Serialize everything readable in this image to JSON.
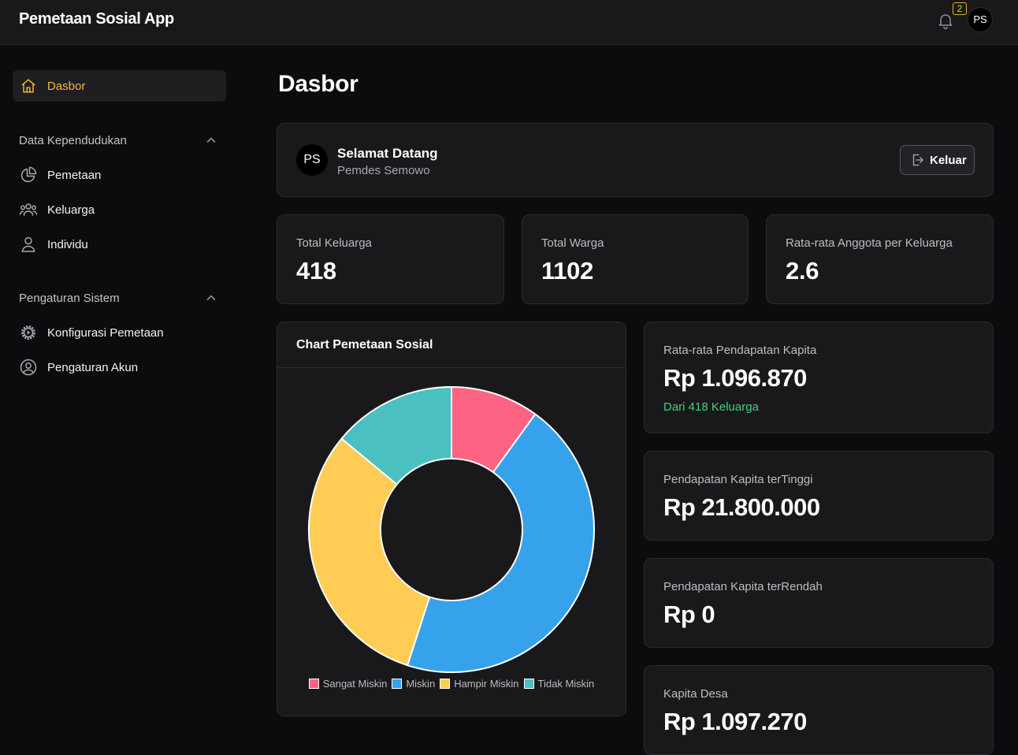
{
  "app": {
    "title": "Pemetaan Sosial App"
  },
  "header": {
    "notification_count": "2",
    "avatar_initials": "PS"
  },
  "sidebar": {
    "active_item": {
      "label": "Dasbor",
      "icon": "home-icon"
    },
    "sections": [
      {
        "title": "Data Kependudukan",
        "items": [
          {
            "label": "Pemetaan",
            "icon": "pie-chart-icon"
          },
          {
            "label": "Keluarga",
            "icon": "users-icon"
          },
          {
            "label": "Individu",
            "icon": "user-icon"
          }
        ]
      },
      {
        "title": "Pengaturan Sistem",
        "items": [
          {
            "label": "Konfigurasi Pemetaan",
            "icon": "gear-icon"
          },
          {
            "label": "Pengaturan Akun",
            "icon": "user-circle-icon"
          }
        ]
      }
    ]
  },
  "page": {
    "title": "Dasbor"
  },
  "welcome": {
    "avatar_initials": "PS",
    "title": "Selamat Datang",
    "subtitle": "Pemdes Semowo",
    "logout_label": "Keluar"
  },
  "stats": [
    {
      "label": "Total Keluarga",
      "value": "418"
    },
    {
      "label": "Total Warga",
      "value": "1102"
    },
    {
      "label": "Rata-rata Anggota per Keluarga",
      "value": "2.6"
    }
  ],
  "finance": [
    {
      "label": "Rata-rata Pendapatan Kapita",
      "value": "Rp 1.096.870",
      "note": "Dari 418 Keluarga"
    },
    {
      "label": "Pendapatan Kapita terTinggi",
      "value": "Rp 21.800.000"
    },
    {
      "label": "Pendapatan Kapita terRendah",
      "value": "Rp 0"
    },
    {
      "label": "Kapita Desa",
      "value": "Rp 1.097.270"
    }
  ],
  "chart_card": {
    "title": "Chart Pemetaan Sosial"
  },
  "chart_data": {
    "type": "pie",
    "title": "Chart Pemetaan Sosial",
    "donut": true,
    "legend_position": "bottom",
    "categories": [
      "Sangat Miskin",
      "Miskin",
      "Hampir Miskin",
      "Tidak Miskin"
    ],
    "values": [
      10,
      45,
      31,
      14
    ],
    "colors": [
      "#ff6384",
      "#36a2eb",
      "#ffcd56",
      "#4bc0c0"
    ]
  },
  "colors": {
    "accent": "#f4b73a",
    "positive": "#3ed27f",
    "background": "#0c0c0e",
    "card": "#19191c"
  }
}
